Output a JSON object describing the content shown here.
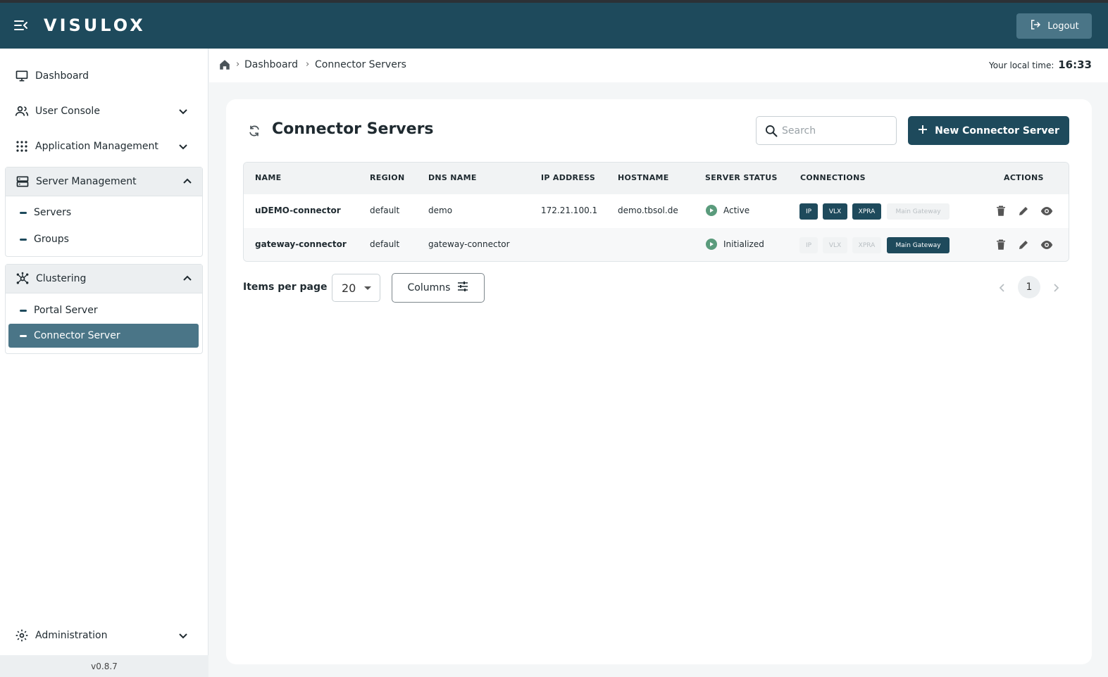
{
  "app": {
    "brand": "VISULOX",
    "logout_label": "Logout"
  },
  "sidebar": {
    "dashboard": "Dashboard",
    "user_console": "User Console",
    "application_management": "Application Management",
    "server_management": "Server Management",
    "server_management_items": [
      "Servers",
      "Groups"
    ],
    "clustering": "Clustering",
    "clustering_items": [
      "Portal Server",
      "Connector Server"
    ],
    "administration": "Administration",
    "version": "v0.8.7"
  },
  "breadcrumb": {
    "items": [
      "Dashboard",
      "Connector Servers"
    ],
    "separator": "›"
  },
  "localtime": {
    "label": "Your local time:",
    "value": "16:33"
  },
  "page": {
    "title": "Connector Servers",
    "search_placeholder": "Search",
    "new_button": "New Connector Server"
  },
  "table": {
    "columns": [
      "NAME",
      "REGION",
      "DNS NAME",
      "IP ADDRESS",
      "HOSTNAME",
      "SERVER STATUS",
      "CONNECTIONS",
      "ACTIONS"
    ],
    "connection_types": [
      "IP",
      "VLX",
      "XPRA",
      "Main Gateway"
    ],
    "rows": [
      {
        "name": "uDEMO-connector",
        "region": "default",
        "dns_name": "demo",
        "ip_address": "172.21.100.1",
        "hostname": "demo.tbsol.de",
        "status": "Active",
        "connections_enabled": [
          true,
          true,
          true,
          false
        ]
      },
      {
        "name": "gateway-connector",
        "region": "default",
        "dns_name": "gateway-connector",
        "ip_address": "",
        "hostname": "",
        "status": "Initialized",
        "connections_enabled": [
          false,
          false,
          false,
          true
        ]
      }
    ]
  },
  "footer": {
    "items_per_page_label": "Items per page",
    "items_per_page_value": "20",
    "columns_label": "Columns",
    "current_page": "1"
  },
  "colors": {
    "primary": "#1e4a5c",
    "accent": "#4a7587",
    "status_green": "#5a9b7c"
  },
  "icons": [
    "menu-icon",
    "logout-icon",
    "monitor-icon",
    "users-icon",
    "grid-icon",
    "server-icon",
    "cluster-icon",
    "gear-icon",
    "home-icon",
    "refresh-icon",
    "search-icon",
    "plus-icon",
    "play-icon",
    "trash-icon",
    "pencil-icon",
    "eye-icon",
    "sliders-icon",
    "chevron-left-icon",
    "chevron-right-icon",
    "chevron-down-icon",
    "chevron-up-icon"
  ]
}
